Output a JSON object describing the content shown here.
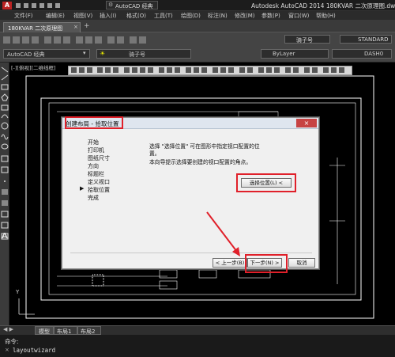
{
  "titlebar": {
    "workspace": "AutoCAD 经典",
    "app_title": "Autodesk AutoCAD 2014    180KVAR 二次原理图.dwg"
  },
  "menubar": {
    "items": [
      "文件(F)",
      "编辑(E)",
      "视图(V)",
      "插入(I)",
      "格式(O)",
      "工具(T)",
      "绘图(D)",
      "标注(N)",
      "修改(M)",
      "参数(P)",
      "窗口(W)",
      "帮助(H)"
    ]
  },
  "file_tabs": {
    "active": "180KVAR 二次原理图"
  },
  "ribbon": {
    "workspace_select": "AutoCAD 经典",
    "font_select": "骑子号",
    "style_select": "STANDARD",
    "linetype_select": "ByLayer",
    "lineweight_label": "DASH0"
  },
  "viewport_label": "[-][俯视][二维线框]",
  "dialog": {
    "title": "创建布局 - 拾取位置",
    "steps": [
      "开始",
      "打印机",
      "图纸尺寸",
      "方向",
      "标题栏",
      "定义视口",
      "拾取位置",
      "完成"
    ],
    "current_step_index": 6,
    "description_1": "选择 \"选择位置\" 可在图形中指定视口配置的位置。",
    "description_2": "本向导提示选择要创建的视口配置的角点。",
    "select_location_button": "选择位置(L) <",
    "back_button": "< 上一步(B)",
    "next_button": "下一步(N) >",
    "cancel_button": "取消"
  },
  "layout_tabs": [
    "模型",
    "布局1",
    "布局2"
  ],
  "command": {
    "label": "命令:",
    "history": "layoutwizard"
  },
  "colors": {
    "highlight": "#e0202a",
    "background": "#000000",
    "dialog_bg": "#f0f0f0"
  }
}
